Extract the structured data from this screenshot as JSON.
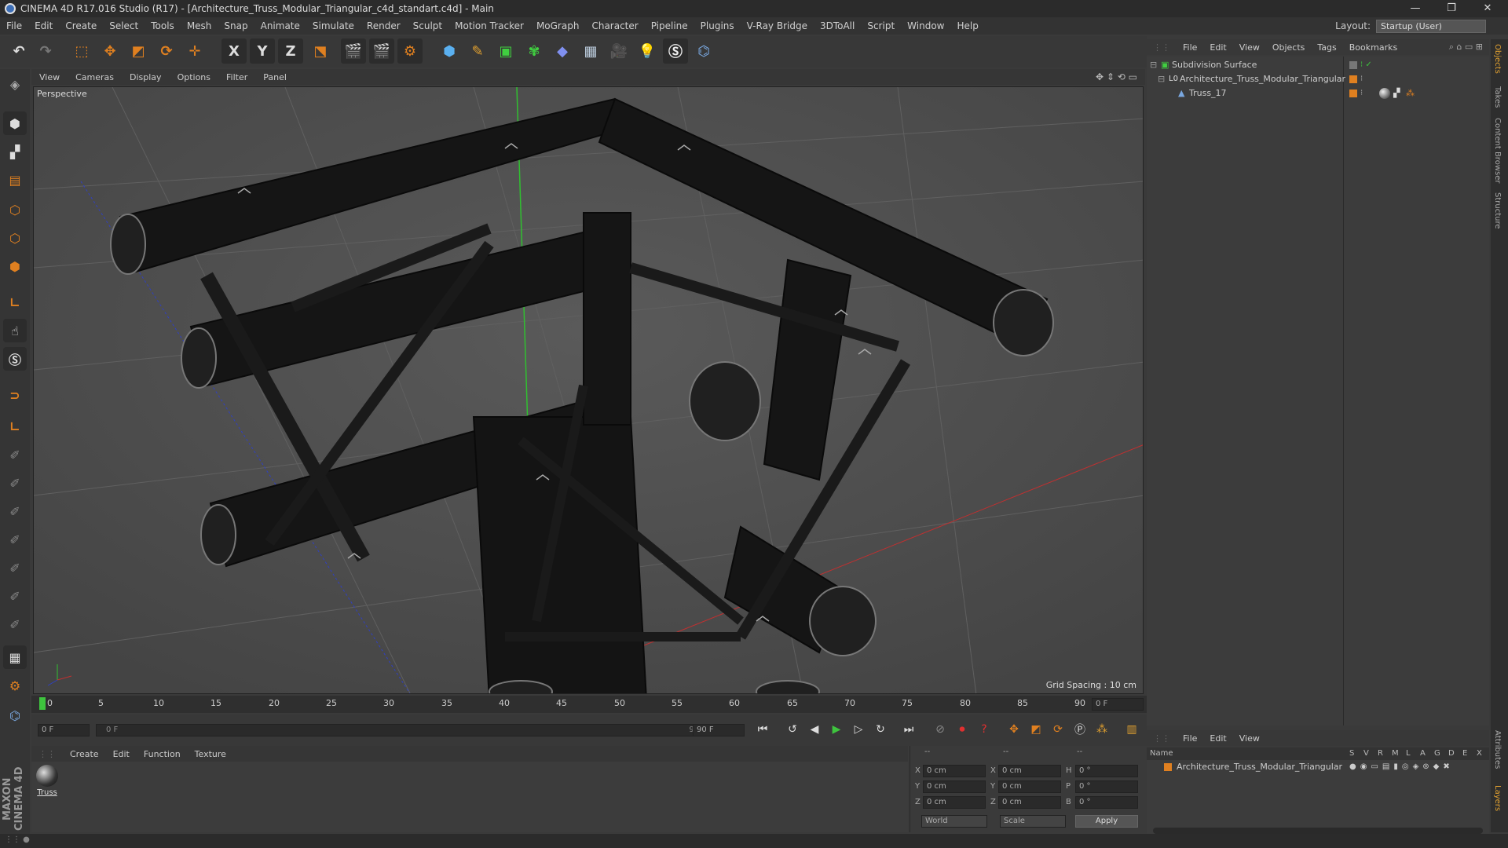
{
  "window": {
    "title": "CINEMA 4D R17.016 Studio (R17) - [Architecture_Truss_Modular_Triangular_c4d_standart.c4d] - Main",
    "minimize": "—",
    "restore": "❐",
    "close": "✕"
  },
  "menu": [
    "File",
    "Edit",
    "Create",
    "Select",
    "Tools",
    "Mesh",
    "Snap",
    "Animate",
    "Simulate",
    "Render",
    "Sculpt",
    "Motion Tracker",
    "MoGraph",
    "Character",
    "Pipeline",
    "Plugins",
    "V-Ray Bridge",
    "3DToAll",
    "Script",
    "Window",
    "Help"
  ],
  "layout": {
    "label": "Layout:",
    "value": "Startup (User)"
  },
  "toolbar": {
    "x_label": "X",
    "y_label": "Y",
    "z_label": "Z"
  },
  "viewport_menu": [
    "View",
    "Cameras",
    "Display",
    "Options",
    "Filter",
    "Panel"
  ],
  "viewport": {
    "name": "Perspective",
    "grid_spacing": "Grid Spacing : 10 cm"
  },
  "timeline": {
    "ticks": [
      "0",
      "5",
      "10",
      "15",
      "20",
      "25",
      "30",
      "35",
      "40",
      "45",
      "50",
      "55",
      "60",
      "65",
      "70",
      "75",
      "80",
      "85",
      "90"
    ],
    "current_frame": "0 F",
    "start_field": "0 F",
    "range_start": "0 F",
    "range_end": "90 F",
    "end_field": "90 F"
  },
  "material_menu": [
    "Create",
    "Edit",
    "Function",
    "Texture"
  ],
  "materials": [
    {
      "name": "Truss"
    }
  ],
  "coords": {
    "header_left": "--",
    "header_mid": "--",
    "header_right": "--",
    "x_label": "X",
    "y_label": "Y",
    "z_label": "Z",
    "x_pos": "0 cm",
    "y_pos": "0 cm",
    "z_pos": "0 cm",
    "x_size": "0 cm",
    "y_size": "0 cm",
    "z_size": "0 cm",
    "h_label": "H",
    "p_label": "P",
    "b_label": "B",
    "h_val": "0 °",
    "p_val": "0 °",
    "b_val": "0 °",
    "mode_world": "World",
    "mode_scale": "Scale",
    "apply": "Apply"
  },
  "object_menu": [
    "File",
    "Edit",
    "View",
    "Objects",
    "Tags",
    "Bookmarks"
  ],
  "objects": [
    {
      "name": "Subdivision Surface"
    },
    {
      "name": "Architecture_Truss_Modular_Triangular"
    },
    {
      "name": "Truss_17"
    }
  ],
  "layer_menu": [
    "File",
    "Edit",
    "View"
  ],
  "layer_header": {
    "name": "Name",
    "cols": [
      "S",
      "V",
      "R",
      "M",
      "L",
      "A",
      "G",
      "D",
      "E",
      "X"
    ]
  },
  "layers": [
    {
      "name": "Architecture_Truss_Modular_Triangular"
    }
  ],
  "right_tabs": [
    "Objects",
    "Takes",
    "Content Browser",
    "Structure",
    "Attributes",
    "Layers"
  ],
  "brand": "MAXON CINEMA 4D",
  "colors": {
    "accent_orange": "#e08020",
    "timeline_green": "#3ec43e",
    "axis_red": "#c03030",
    "axis_green": "#30c030",
    "axis_blue": "#3040c0"
  }
}
